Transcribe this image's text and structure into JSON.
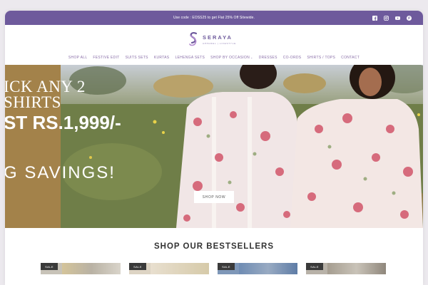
{
  "announcement": {
    "text": "Use code : EOSS25 to get Flat 25% Off Sitewide."
  },
  "social": [
    "facebook-icon",
    "instagram-icon",
    "youtube-icon",
    "pinterest-icon"
  ],
  "brand": {
    "name": "SERAYA",
    "tagline": "APPAREL | LIFESTYLE"
  },
  "nav": [
    "SHOP ALL",
    "FESTIVE EDIT",
    "SUITS SETS",
    "KURTAS",
    "LEHENGA SETS",
    "SHOP BY OCCASION",
    "DRESSES",
    "CO-ORDS",
    "SHIRTS / TOPS",
    "CONTACT"
  ],
  "hero": {
    "line1": "ICK ANY 2",
    "line2": "SHIRTS",
    "line3": "ST RS.1,999/-",
    "line4": "G SAVINGS!",
    "cta": "SHOP NOW"
  },
  "bestsellers": {
    "title": "SHOP OUR BESTSELLERS",
    "badge": "SALE",
    "count": 4
  },
  "colors": {
    "brand_purple": "#6e5a9c",
    "hero_panel": "#a3824a"
  }
}
